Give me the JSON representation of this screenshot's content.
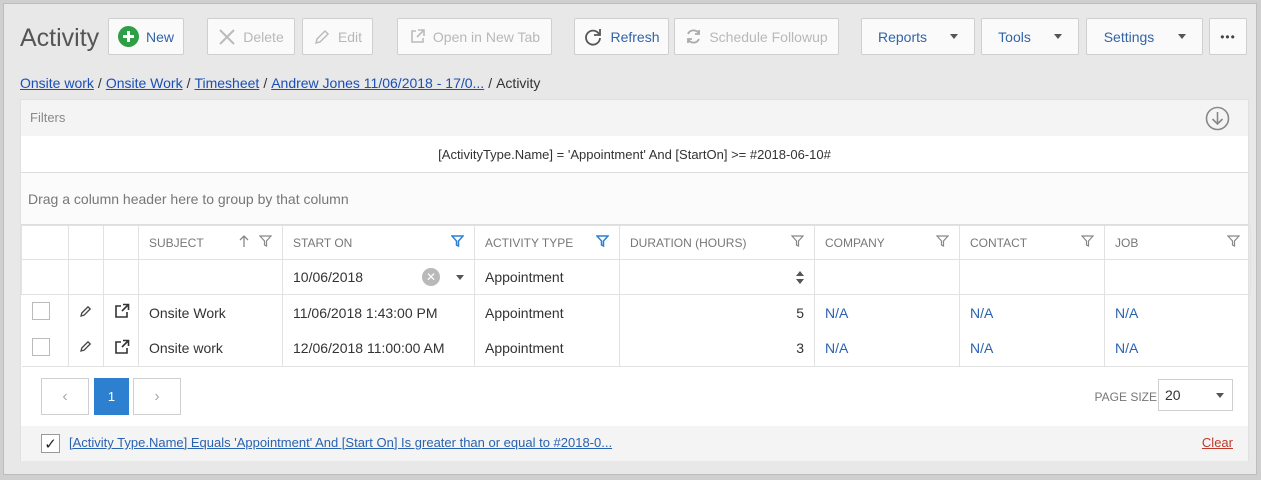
{
  "page": {
    "title": "Activity"
  },
  "toolbar": {
    "new_label": "New",
    "delete_label": "Delete",
    "edit_label": "Edit",
    "open_new_tab_label": "Open in New Tab",
    "refresh_label": "Refresh",
    "schedule_followup_label": "Schedule Followup",
    "reports_label": "Reports",
    "tools_label": "Tools",
    "settings_label": "Settings",
    "more_label": "•••"
  },
  "breadcrumb": {
    "items": [
      "Onsite work",
      "Onsite Work",
      "Timesheet",
      "Andrew Jones 11/06/2018 - 17/0..."
    ],
    "current": "Activity",
    "separator": "/"
  },
  "filters": {
    "label": "Filters",
    "expression": "[ActivityType.Name] = 'Appointment' And [StartOn] >= #2018-06-10#",
    "group_hint": "Drag a column header here to group by that column"
  },
  "grid": {
    "columns": [
      "SUBJECT",
      "START ON",
      "ACTIVITY TYPE",
      "DURATION (HOURS)",
      "COMPANY",
      "CONTACT",
      "JOB"
    ],
    "filter_row": {
      "start_on": "10/06/2018",
      "activity_type": "Appointment"
    },
    "rows": [
      {
        "subject": "Onsite Work",
        "start_on": "11/06/2018 1:43:00 PM",
        "activity_type": "Appointment",
        "duration": "5",
        "company": "N/A",
        "contact": "N/A",
        "job": "N/A"
      },
      {
        "subject": "Onsite work",
        "start_on": "12/06/2018 11:00:00 AM",
        "activity_type": "Appointment",
        "duration": "3",
        "company": "N/A",
        "contact": "N/A",
        "job": "N/A"
      }
    ]
  },
  "pager": {
    "prev": "‹",
    "current_page": "1",
    "next": "›",
    "page_size_label": "PAGE SIZE",
    "page_size": "20"
  },
  "filter_footer": {
    "check": "✓",
    "text": "[Activity Type.Name] Equals 'Appointment' And [Start On] Is greater than or equal to #2018-0...",
    "clear_label": "Clear"
  },
  "colors": {
    "accent": "#2d7fd0",
    "link": "#1a4fb5",
    "new_icon": "#2e9e47",
    "clear_link": "#c0392b"
  },
  "icons": {
    "new": "plus-circle-icon",
    "delete": "x-icon",
    "edit": "pencil-icon",
    "open_new_tab": "external-link-icon",
    "refresh": "refresh-icon",
    "schedule_followup": "sync-icon",
    "filters_download": "download-circle-icon",
    "sort": "sort-up-icon",
    "filter": "funnel-icon"
  }
}
